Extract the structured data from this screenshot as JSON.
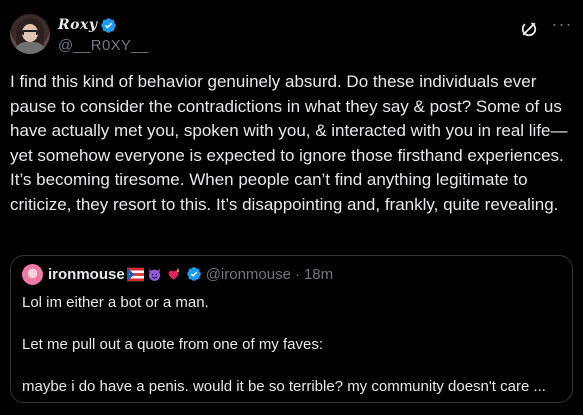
{
  "post": {
    "author": {
      "display_name": "Roxy",
      "handle": "@__R0XY__",
      "verified": true,
      "verified_color": "#1d9bf0"
    },
    "text": "I find this kind of behavior genuinely absurd. Do these individuals ever pause to consider the contradictions in what they say & post? Some of us have actually met you, spoken with you, & interacted with you in real life—yet somehow everyone is expected to ignore those firsthand experiences. It’s becoming tiresome. When people can’t find anything legitimate to criticize, they resort to this. It’s disappointing and, frankly, quite revealing.",
    "actions": {
      "grok": "grok-icon",
      "more": "···"
    }
  },
  "quoted_post": {
    "author": {
      "display_name": "ironmouse",
      "emojis": [
        "puerto-rico-flag",
        "smiling-devil",
        "heart-on-fire"
      ],
      "verified": true,
      "handle": "@ironmouse",
      "separator": "·",
      "time": "18m"
    },
    "lines": [
      "Lol im either a bot or a man.",
      "",
      "Let me pull out a quote from one of my faves:",
      "",
      "maybe i do have a penis. would it be so terrible? my community doesn't care ..."
    ]
  },
  "colors": {
    "background": "#000000",
    "text": "#e7e9ea",
    "secondary": "#71767b",
    "border": "#2f3336",
    "accent": "#1d9bf0"
  }
}
